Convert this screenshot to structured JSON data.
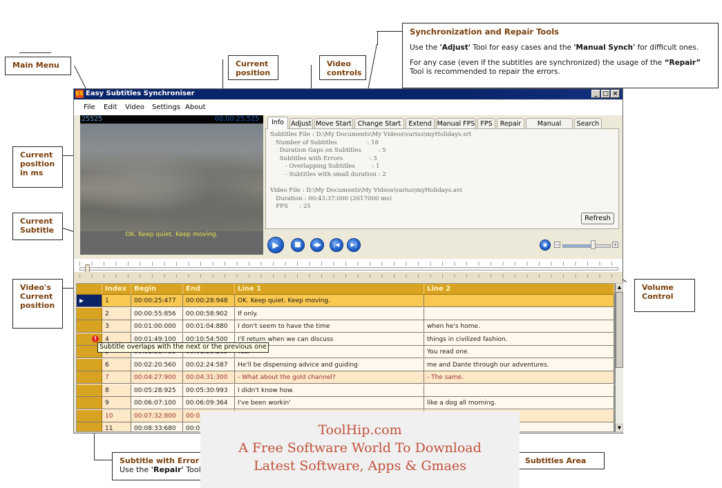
{
  "annotations": {
    "main_menu": "Main Menu",
    "current_position": "Current position",
    "video_controls": "Video controls",
    "current_position_ms": "Current position in ms",
    "current_subtitle": "Current Subtitle",
    "videos_current_position": "Video's Current position",
    "volume_control": "Volume Control",
    "subtitle_with_error_title": "Subtitle with Error",
    "subtitle_with_error_prefix": "Use the ",
    "subtitle_with_error_bold": "'Repair'",
    "subtitle_with_error_suffix": " Tool",
    "subtitles_area": "Subtitles Area",
    "sync_tools": {
      "title": "Synchronization and Repair Tools",
      "line1_a": "Use the ",
      "line1_b": "'Adjust'",
      "line1_c": " Tool for easy cases and the ",
      "line1_d": "'Manual Synch'",
      "line1_e": " for difficult ones.",
      "line2_a": "For any case (even if the subtitles are synchronized) the usage of the ",
      "line2_b": "“Repair”",
      "line2_c": " Tool is recommended to repair the errors."
    }
  },
  "window": {
    "app_icon": "ES",
    "title": "Easy Subtitles Synchroniser",
    "controls": [
      "_",
      "□",
      "×"
    ]
  },
  "menu": [
    "File",
    "Edit",
    "Video",
    "Settings",
    "About"
  ],
  "video": {
    "position_ms": "25525",
    "position_time": "00:00:25:525",
    "current_subtitle": "OK. Keep quiet. Keep moving."
  },
  "tabs": [
    "Info",
    "Adjust",
    "Move Start",
    "Change Start",
    "Extend",
    "Manual FPS",
    "FPS",
    "Repair",
    "Manual Synch",
    "Search"
  ],
  "active_tab": "Info",
  "info": {
    "lines": [
      "Subtitles File : D:\\My Documents\\My Videos\\varius\\myHolidays.srt",
      "   Number of Subtitles                : 18",
      "     Duration Gaps on Subtitles         : 5",
      "     Subtitles with Errors              : 3",
      "        - Overlapping Subtitles         : 1",
      "        - Subtitles with small duration : 2",
      "",
      "Video File : D:\\My Documents\\My Videos\\varius\\myHolidays.avi",
      "   Duration : 00:43:37:000 (2617000 ms)",
      "   FPS      : 25"
    ],
    "refresh_label": "Refresh"
  },
  "controls": {
    "play": "▶",
    "stop": "■",
    "step": "◀▶",
    "prev": "|◀",
    "next": "▶|",
    "volume": "◉",
    "volume_minus": "−",
    "volume_plus": "+",
    "volume_level": 0.65,
    "seek_position_fraction": 0.01
  },
  "grid": {
    "columns": [
      "",
      "Index",
      "Begin",
      "End",
      "Line 1",
      "Line 2"
    ],
    "rows": [
      {
        "index": "1",
        "begin": "00:00:25:477",
        "end": "00:00:28:948",
        "line1": "OK. Keep quiet. Keep moving.",
        "line2": "",
        "state": "selected"
      },
      {
        "index": "2",
        "begin": "00:00:55:856",
        "end": "00:00:58:902",
        "line1": "If only.",
        "line2": "",
        "state": "normal"
      },
      {
        "index": "3",
        "begin": "00:01:00:000",
        "end": "00:01:04:880",
        "line1": "I don't seem to have the time",
        "line2": "when he's home.",
        "state": "normal"
      },
      {
        "index": "4",
        "begin": "00:01:49:100",
        "end": "00:10:54:500",
        "line1": "I'll return when we can discuss",
        "line2": "things in civilized fashion.",
        "state": "normal"
      },
      {
        "index": "5",
        "begin": "00:01:53:733",
        "end": "00:01:58:265",
        "line1": "Yes.",
        "line2": "You read one.",
        "state": "normal"
      },
      {
        "index": "6",
        "begin": "00:02:20:560",
        "end": "00:02:24:587",
        "line1": "He'll be dispensing advice and guiding",
        "line2": "me and Dante through our adventures.",
        "state": "normal"
      },
      {
        "index": "7",
        "begin": "00:04:27:900",
        "end": "00:04:31:300",
        "line1": "- What about the gold channel?",
        "line2": "- The same.",
        "state": "alt-error"
      },
      {
        "index": "8",
        "begin": "00:05:28:925",
        "end": "00:05:30:993",
        "line1": "I didn't know how.",
        "line2": "",
        "state": "normal"
      },
      {
        "index": "9",
        "begin": "00:06:07:100",
        "end": "00:06:09:364",
        "line1": "I've been workin'",
        "line2": "like a dog all morning.",
        "state": "normal"
      },
      {
        "index": "10",
        "begin": "00:07:32:800",
        "end": "00:07",
        "line1": "",
        "line2": "",
        "state": "alt-error"
      },
      {
        "index": "11",
        "begin": "00:08:33:680",
        "end": "00:08",
        "line1": "",
        "line2": "",
        "state": "normal"
      }
    ],
    "error_icon": "!",
    "error_tooltip": "Subtitle overlaps with the next or the previous one"
  },
  "watermark": {
    "line1": "ToolHip.com",
    "line2": "A Free Software World To Download",
    "line3": "Latest Software, Apps & Gmaes"
  }
}
